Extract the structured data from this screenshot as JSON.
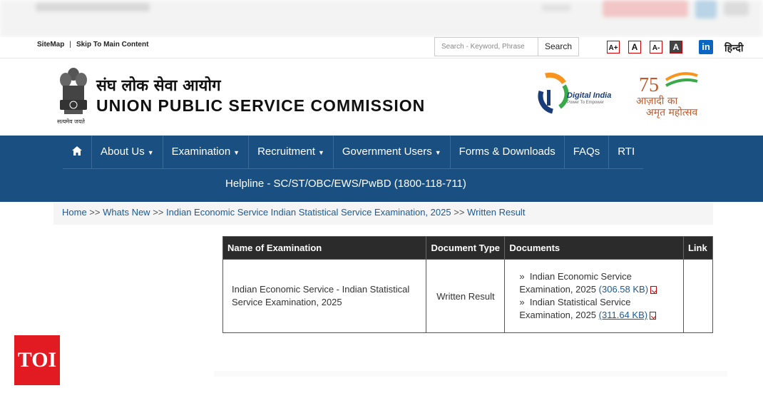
{
  "top_bar": {
    "sitemap": "SiteMap",
    "separator": "|",
    "skip": "Skip To Main Content",
    "search_placeholder": "Search - Keyword, Phrase",
    "search_button": "Search",
    "font_large": "A+",
    "font_normal": "A",
    "font_small": "A-",
    "font_contrast": "A",
    "linkedin": "in",
    "language": "हिन्दी"
  },
  "header": {
    "title_hindi": "संघ लोक सेवा आयोग",
    "title_english": "UNION PUBLIC SERVICE COMMISSION",
    "emblem_caption": "सत्यमेव जयते",
    "digital_india": "Digital India",
    "digital_india_tagline": "Power To Empower",
    "azadi_line1": "आज़ादी का",
    "azadi_line2": "अमृत महोत्सव",
    "azadi_number": "75"
  },
  "nav": {
    "items": [
      {
        "label": "About Us",
        "dropdown": true
      },
      {
        "label": "Examination",
        "dropdown": true
      },
      {
        "label": "Recruitment",
        "dropdown": true
      },
      {
        "label": "Government Users",
        "dropdown": true
      },
      {
        "label": "Forms & Downloads",
        "dropdown": false
      },
      {
        "label": "FAQs",
        "dropdown": false
      },
      {
        "label": "RTI",
        "dropdown": false
      }
    ],
    "helpline": "Helpline - SC/ST/OBC/EWS/PwBD (1800-118-711)"
  },
  "breadcrumb": {
    "home": "Home",
    "whats_new": "Whats New",
    "exam": "Indian Economic Service Indian Statistical Service Examination, 2025",
    "current": "Written Result",
    "sep": " >> "
  },
  "table": {
    "headers": [
      "Name of Examination",
      "Document Type",
      "Documents",
      "Link"
    ],
    "row": {
      "name": "Indian Economic Service - Indian Statistical Service Examination, 2025",
      "type": "Written Result",
      "docs": [
        {
          "bullet": "»",
          "text": "Indian Economic Service Examination, 2025",
          "size": "(306.58 KB)"
        },
        {
          "bullet": "»",
          "text": "Indian Statistical Service Examination, 2025",
          "size": "(311.64 KB)"
        }
      ]
    }
  },
  "watermark": "TOI",
  "colors": {
    "nav_bg": "#1a4f82",
    "table_header": "#2b2b2b",
    "link": "#1a5a96",
    "toi_red": "#e21b22"
  }
}
